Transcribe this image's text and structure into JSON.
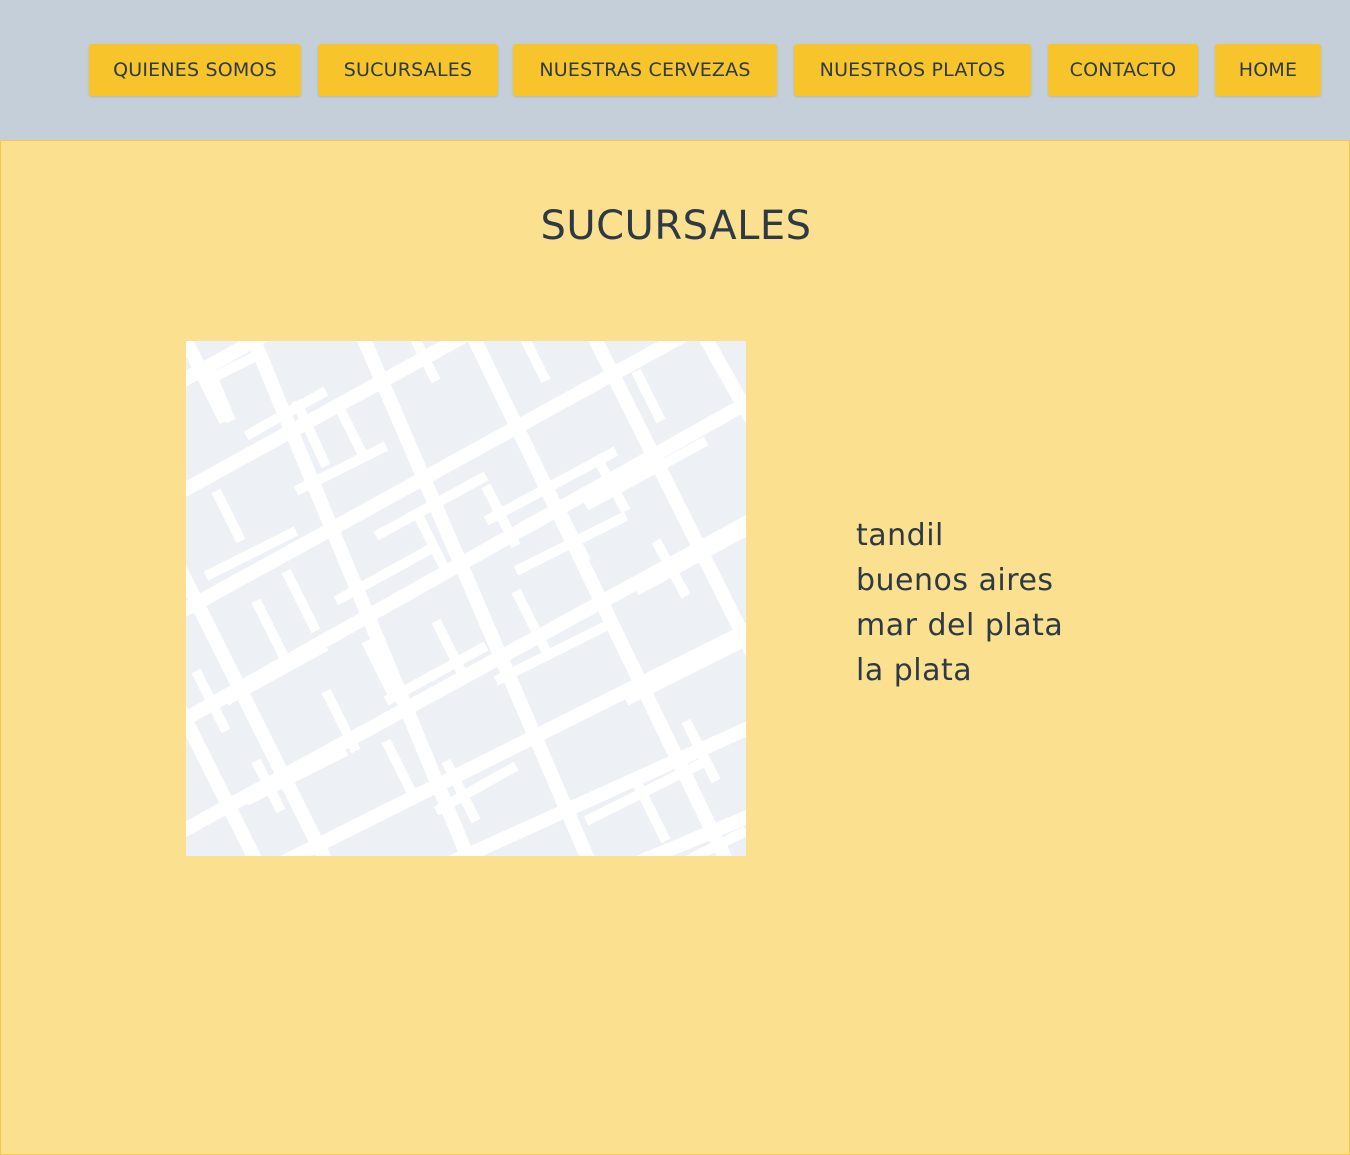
{
  "nav": {
    "items": [
      {
        "label": "QUIENES SOMOS"
      },
      {
        "label": "SUCURSALES"
      },
      {
        "label": "NUESTRAS CERVEZAS"
      },
      {
        "label": "NUESTROS PLATOS"
      },
      {
        "label": "CONTACTO"
      },
      {
        "label": "HOME"
      }
    ]
  },
  "main": {
    "title": "SUCURSALES",
    "branches": [
      "tandil",
      "buenos aires",
      "mar del plata",
      "la plata"
    ]
  },
  "colors": {
    "header_bg": "#c4cfd9",
    "nav_button_bg": "#f7c52b",
    "content_bg": "#fbe08f",
    "text": "#2d3a45",
    "map_block": "#edf0f5",
    "map_street": "#ffffff"
  },
  "icons": {
    "map": "map-placeholder"
  }
}
